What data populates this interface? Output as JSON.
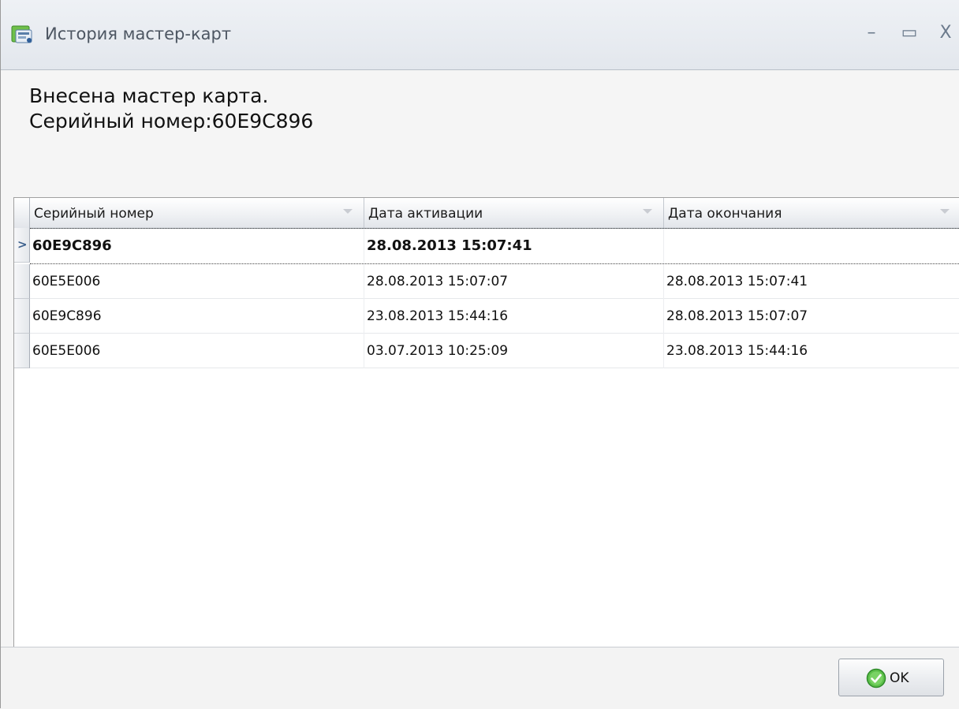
{
  "window": {
    "title": "История мастер-карт",
    "minimize_icon": "minimize-icon",
    "maximize_icon": "maximize-icon",
    "close_icon": "close-icon"
  },
  "message": {
    "line1": "Внесена мастер карта.",
    "line2": "Серийный номер:60E9C896"
  },
  "grid": {
    "columns": [
      "Серийный номер",
      "Дата активации",
      "Дата окончания"
    ],
    "rows": [
      {
        "serial": "60E9C896",
        "activation": "28.08.2013 15:07:41",
        "end": "",
        "focused": true
      },
      {
        "serial": "60E5E006",
        "activation": "28.08.2013 15:07:07",
        "end": "28.08.2013 15:07:41"
      },
      {
        "serial": "60E9C896",
        "activation": "23.08.2013 15:44:16",
        "end": "28.08.2013 15:07:07"
      },
      {
        "serial": "60E5E006",
        "activation": "03.07.2013 10:25:09",
        "end": "23.08.2013 15:44:16"
      }
    ]
  },
  "footer": {
    "ok_label": "OK"
  },
  "colors": {
    "title_text": "#4d5662",
    "accent_blue": "#3b5f8c",
    "ok_check_green": "#3aa53a"
  }
}
